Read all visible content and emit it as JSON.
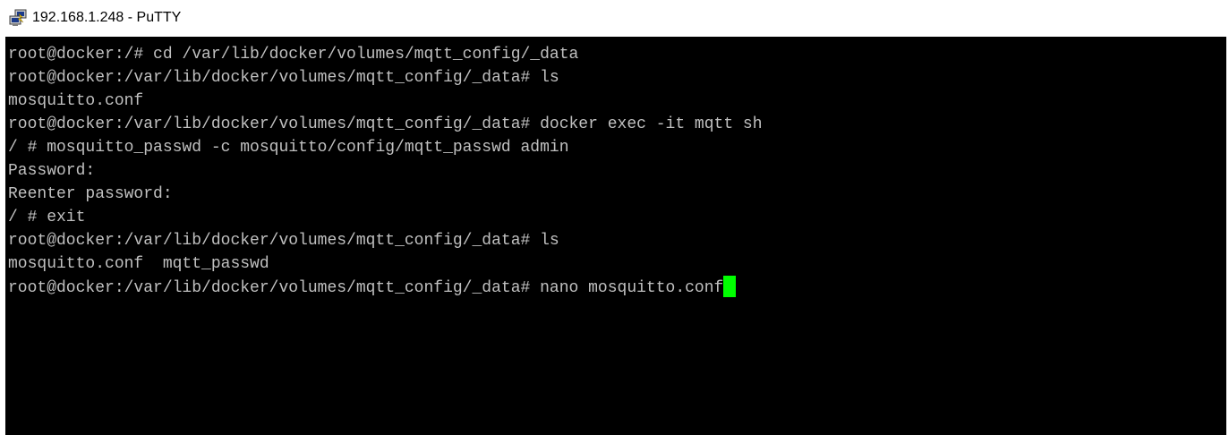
{
  "window": {
    "title": "192.168.1.248 - PuTTY",
    "icon": "putty-icon"
  },
  "terminal": {
    "lines": [
      "root@docker:/# cd /var/lib/docker/volumes/mqtt_config/_data",
      "root@docker:/var/lib/docker/volumes/mqtt_config/_data# ls",
      "mosquitto.conf",
      "root@docker:/var/lib/docker/volumes/mqtt_config/_data# docker exec -it mqtt sh",
      "/ # mosquitto_passwd -c mosquitto/config/mqtt_passwd admin",
      "Password:",
      "Reenter password:",
      "/ # exit",
      "root@docker:/var/lib/docker/volumes/mqtt_config/_data# ls",
      "mosquitto.conf  mqtt_passwd",
      "root@docker:/var/lib/docker/volumes/mqtt_config/_data# nano mosquitto.conf"
    ],
    "foreground_color": "#c0c0c0",
    "background_color": "#000000",
    "cursor_color": "#00ff00"
  }
}
